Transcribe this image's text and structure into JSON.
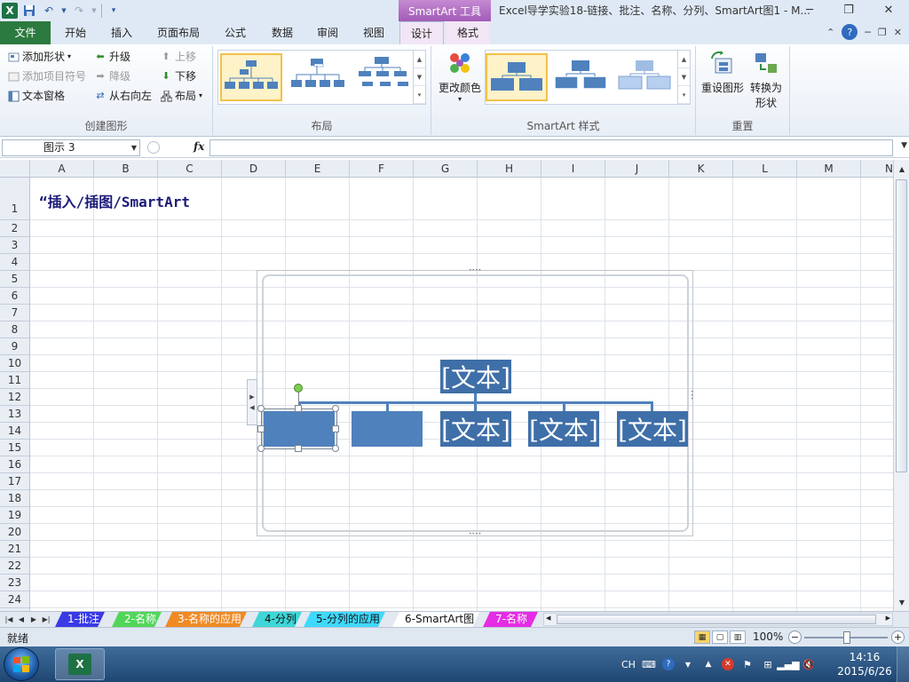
{
  "window": {
    "title": "Excel导学实验18-链接、批注、名称、分列、SmartArt图1 - M...",
    "context_tab_title": "SmartArt 工具"
  },
  "tabs": [
    {
      "label": "文件"
    },
    {
      "label": "开始"
    },
    {
      "label": "插入"
    },
    {
      "label": "页面布局"
    },
    {
      "label": "公式"
    },
    {
      "label": "数据"
    },
    {
      "label": "审阅"
    },
    {
      "label": "视图"
    },
    {
      "label": "设计"
    },
    {
      "label": "格式"
    }
  ],
  "ribbon": {
    "create_graphic": {
      "label": "创建图形",
      "add_shape": "添加形状",
      "add_bullet": "添加项目符号",
      "text_pane": "文本窗格",
      "promote": "升级",
      "demote": "降级",
      "right_to_left": "从右向左",
      "move_up": "上移",
      "move_down": "下移",
      "layout": "布局"
    },
    "layouts": {
      "label": "布局"
    },
    "styles": {
      "label": "SmartArt 样式",
      "change_colors": "更改颜色"
    },
    "reset": {
      "label": "重置",
      "reset_graphic": "重设图形",
      "convert_line1": "转换为",
      "convert_line2": "形状"
    }
  },
  "formula_bar": {
    "name_box": "图示 3",
    "fx": "fx",
    "formula": ""
  },
  "columns": [
    "A",
    "B",
    "C",
    "D",
    "E",
    "F",
    "G",
    "H",
    "I",
    "J",
    "K",
    "L",
    "M",
    "N"
  ],
  "rows": [
    "1",
    "2",
    "3",
    "4",
    "5",
    "6",
    "7",
    "8",
    "9",
    "10",
    "11",
    "12",
    "13",
    "14",
    "15",
    "16",
    "17",
    "18",
    "19",
    "20",
    "21",
    "22",
    "23",
    "24"
  ],
  "cells": {
    "A1": "“插入/插图/SmartArt"
  },
  "smartart": {
    "top_text": "[文本]",
    "children": [
      "",
      "",
      "[文本]",
      "[文本]",
      "[文本]"
    ],
    "color": "#4f81bd"
  },
  "sheet_tabs": [
    {
      "label": "1-批注",
      "color": "#3a3ae6"
    },
    {
      "label": "2-名称",
      "color": "#52d65a"
    },
    {
      "label": "3-名称的应用",
      "color": "#f08a24"
    },
    {
      "label": "4-分列",
      "color": "#3ed6d6"
    },
    {
      "label": "5-分列的应用",
      "color": "#3fd9ff"
    },
    {
      "label": "6-SmartArt图",
      "color": "#ffffff",
      "active": true
    },
    {
      "label": "7-名称",
      "color": "#e52ce5"
    }
  ],
  "status": {
    "ready": "就绪",
    "zoom": "100%"
  },
  "taskbar": {
    "ime": "CH",
    "time": "14:16",
    "date": "2015/6/26"
  }
}
